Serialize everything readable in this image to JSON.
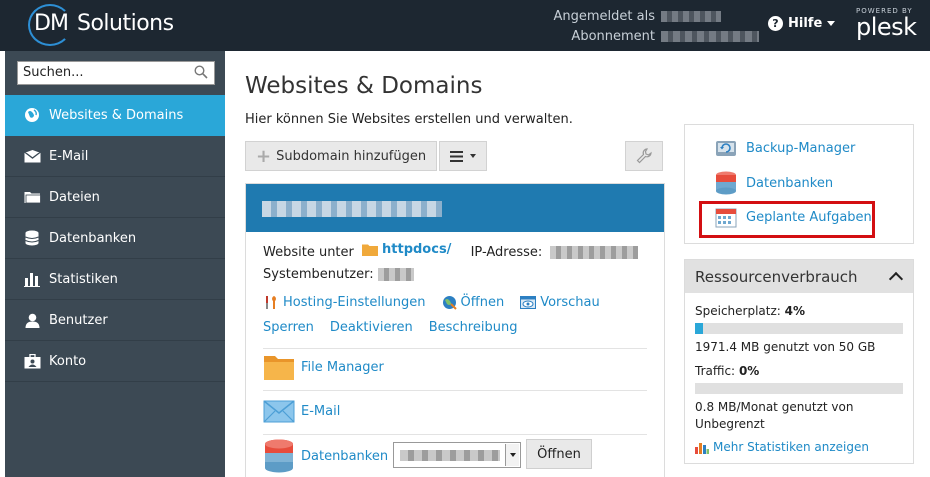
{
  "header": {
    "logo_dm": "DM",
    "logo_solutions": "Solutions",
    "logged_in_label": "Angemeldet als",
    "subscription_label": "Abonnement",
    "help_label": "Hilfe",
    "powered_by": "POWERED BY",
    "plesk": "plesk"
  },
  "sidebar": {
    "search_placeholder": "Suchen...",
    "items": [
      {
        "label": "Websites & Domains",
        "icon": "globe-icon",
        "active": true
      },
      {
        "label": "E-Mail",
        "icon": "mail-icon"
      },
      {
        "label": "Dateien",
        "icon": "folder-icon"
      },
      {
        "label": "Datenbanken",
        "icon": "database-icon"
      },
      {
        "label": "Statistiken",
        "icon": "bar-chart-icon"
      },
      {
        "label": "Benutzer",
        "icon": "user-icon"
      },
      {
        "label": "Konto",
        "icon": "id-card-icon"
      }
    ]
  },
  "main": {
    "title": "Websites & Domains",
    "description": "Hier können Sie Websites erstellen und verwalten.",
    "add_subdomain": "Subdomain hinzufügen"
  },
  "card": {
    "website_under": "Website unter",
    "docroot": "httpdocs/",
    "ip_label": "IP-Adresse:",
    "sysuser_label": "Systembenutzer:",
    "hosting_settings": "Hosting-Einstellungen",
    "open": "Öffnen",
    "preview": "Vorschau",
    "suspend": "Sperren",
    "deactivate": "Deaktivieren",
    "description": "Beschreibung",
    "file_manager": "File Manager",
    "email": "E-Mail",
    "databases": "Datenbanken",
    "open_button": "Öffnen"
  },
  "tools": {
    "backup": "Backup-Manager",
    "databases": "Datenbanken",
    "scheduled_tasks": "Geplante Aufgaben"
  },
  "resources": {
    "title": "Ressourcenverbrauch",
    "disk_label": "Speicherplatz:",
    "disk_pct": "4%",
    "disk_fraction": 0.04,
    "disk_text": "1971.4 MB genutzt von 50 GB",
    "traffic_label": "Traffic:",
    "traffic_pct": "0%",
    "traffic_fraction": 0.0,
    "traffic_text1": "0.8 MB/Monat genutzt von",
    "traffic_text2": "Unbegrenzt",
    "more_stats": "Mehr Statistiken anzeigen"
  },
  "colors": {
    "header_bg": "#1d2731",
    "sidebar_bg": "#3c4954",
    "active": "#2aa7d8",
    "link": "#1f8ac7",
    "highlight": "#d30f12"
  }
}
